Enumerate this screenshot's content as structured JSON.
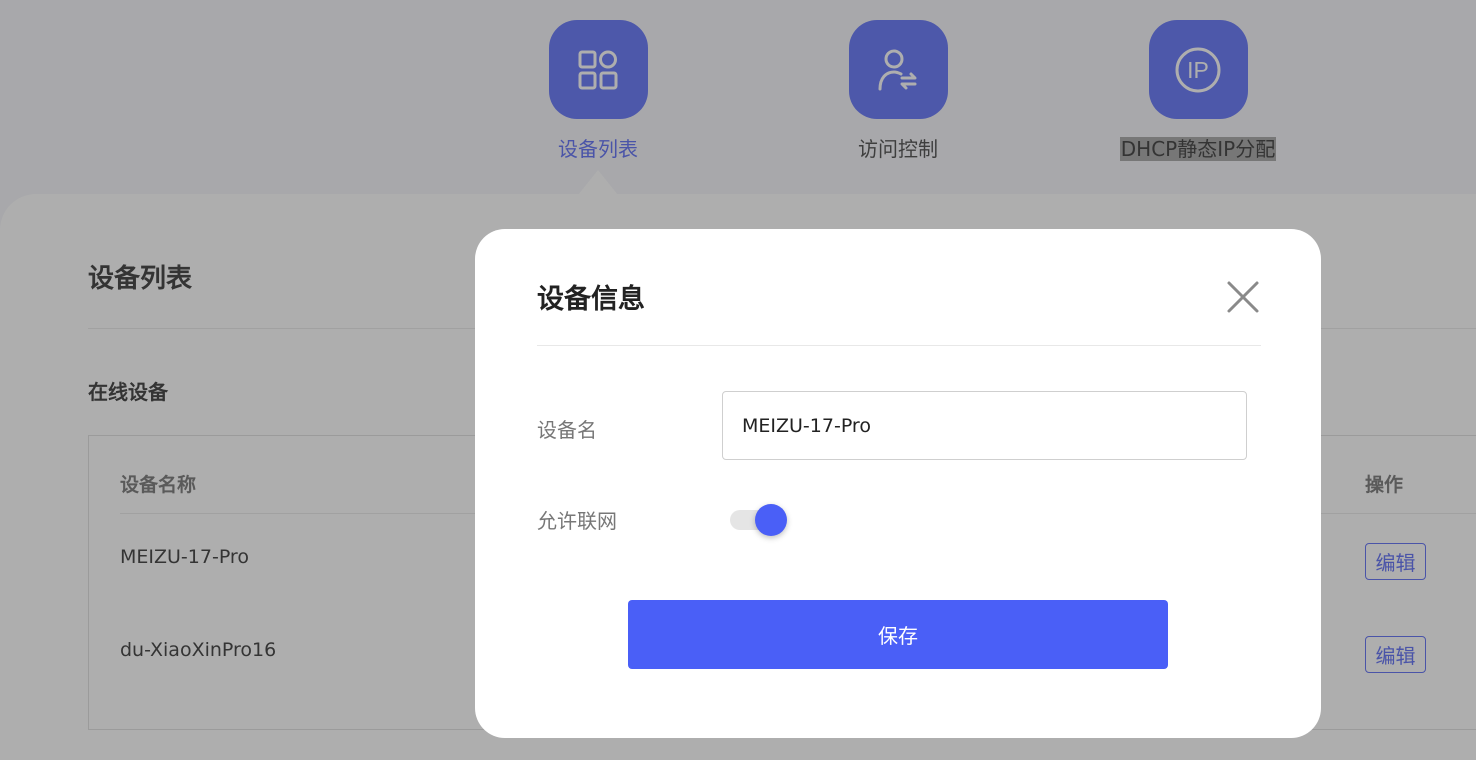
{
  "nav": {
    "items": [
      {
        "label": "设备列表",
        "icon": "grid-apps-icon",
        "active": true
      },
      {
        "label": "访问控制",
        "icon": "user-transfer-icon",
        "active": false
      },
      {
        "label": "DHCP静态IP分配",
        "icon": "ip-icon",
        "active": false,
        "icon_text": "IP"
      }
    ]
  },
  "page": {
    "title": "设备列表",
    "section_title": "在线设备",
    "table": {
      "columns": {
        "name": "设备名称",
        "action": "操作"
      },
      "rows": [
        {
          "name": "MEIZU-17-Pro",
          "action_label": "编辑"
        },
        {
          "name": "du-XiaoXinPro16",
          "action_label": "编辑"
        }
      ]
    }
  },
  "modal": {
    "title": "设备信息",
    "device_name_label": "设备名",
    "device_name_value": "MEIZU-17-Pro",
    "allow_internet_label": "允许联网",
    "allow_internet_enabled": true,
    "save_label": "保存"
  },
  "colors": {
    "accent": "#4a5ff7",
    "nav_icon_bg": "#4f63f7",
    "overlay": "rgba(75,75,75,0.45)"
  }
}
